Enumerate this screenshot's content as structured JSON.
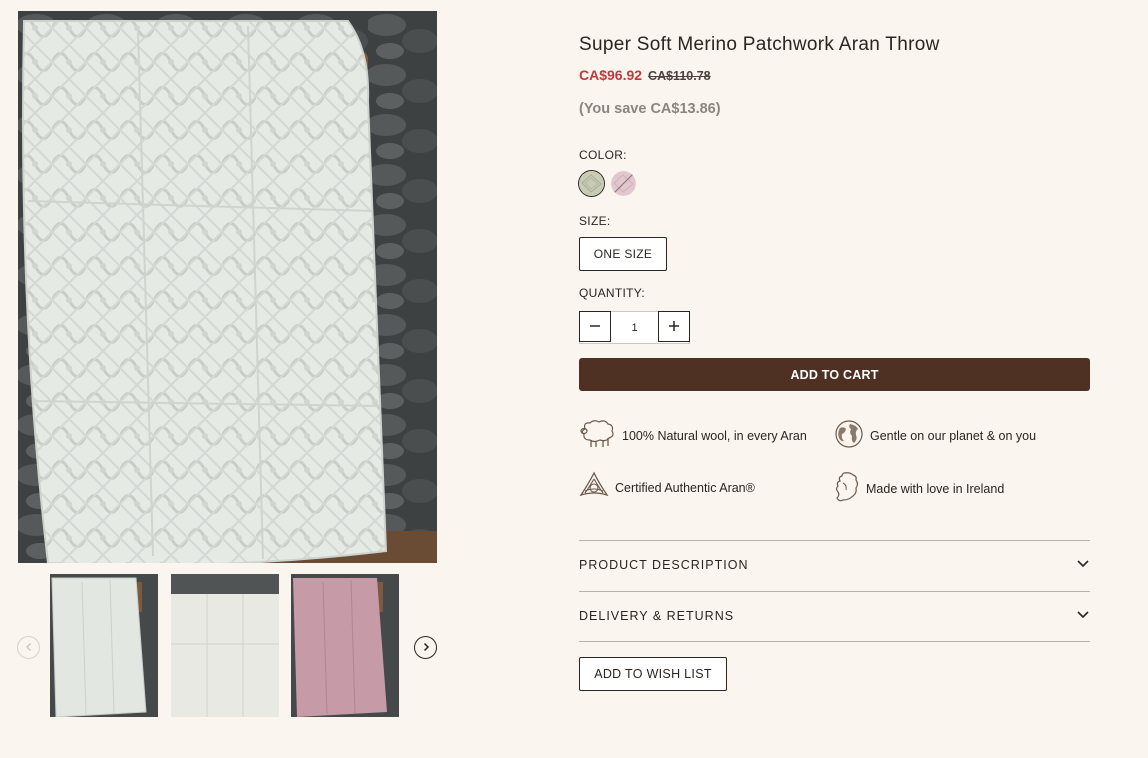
{
  "product": {
    "title": "Super Soft Merino Patchwork Aran Throw",
    "price_sale": "CA$96.92",
    "price_original": "CA$110.78",
    "savings": "(You save CA$13.86)"
  },
  "options": {
    "color_label": "COLOR:",
    "colors": [
      {
        "name": "natural",
        "hex": "#c9ccb4",
        "selected": true
      },
      {
        "name": "pink",
        "hex": "#e3c7cf",
        "selected": false,
        "sold_out": true
      }
    ],
    "size_label": "SIZE:",
    "size_value": "ONE SIZE",
    "quantity_label": "QUANTITY:",
    "quantity_value": "1"
  },
  "actions": {
    "add_to_cart": "ADD TO CART",
    "add_to_wishlist": "ADD TO WISH LIST"
  },
  "features": [
    {
      "icon": "sheep-icon",
      "text": "100% Natural wool, in every Aran"
    },
    {
      "icon": "globe-icon",
      "text": "Gentle on our planet & on you"
    },
    {
      "icon": "celtic-knot-icon",
      "text": "Certified Authentic Aran®"
    },
    {
      "icon": "ireland-map-icon",
      "text": "Made with love in Ireland"
    }
  ],
  "accordions": [
    {
      "label": "PRODUCT DESCRIPTION"
    },
    {
      "label": "DELIVERY & RETURNS"
    }
  ],
  "gallery": {
    "thumbnails": [
      {
        "name": "cream-throw-chair",
        "color": "#e4e7e2"
      },
      {
        "name": "cream-throw-flat",
        "color": "#e8e9e2"
      },
      {
        "name": "pink-throw-chair",
        "color": "#c79aa8"
      }
    ]
  },
  "colors": {
    "background": "#faf5ef",
    "accent_price": "#c0393b",
    "cart_button": "#4e3123"
  }
}
